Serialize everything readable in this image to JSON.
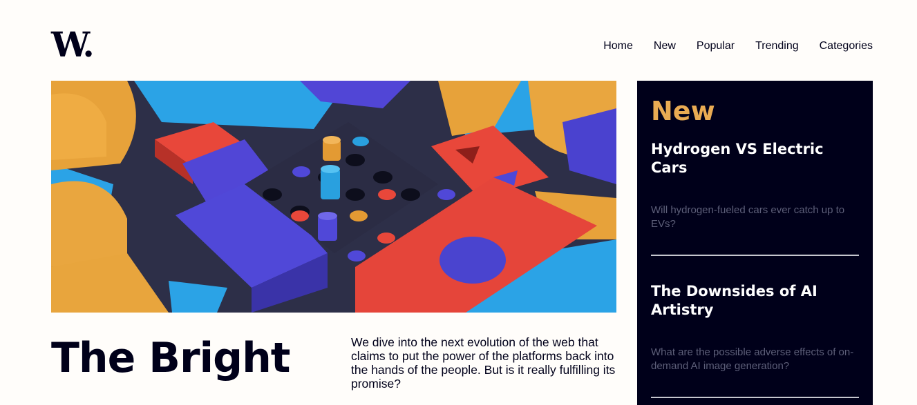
{
  "brand": {
    "logo_text": "W."
  },
  "nav": {
    "items": [
      {
        "label": "Home"
      },
      {
        "label": "New"
      },
      {
        "label": "Popular"
      },
      {
        "label": "Trending"
      },
      {
        "label": "Categories"
      }
    ]
  },
  "hero": {
    "headline": "The Bright",
    "intro": "We dive into the next evolution of the web that claims to put the power of the platforms back into the hands of the people. But is it really fulfilling its promise?"
  },
  "sidebar": {
    "title": "New",
    "articles": [
      {
        "title": "Hydrogen VS Electric Cars",
        "description": "Will hydrogen-fueled cars ever catch up to EVs?"
      },
      {
        "title": "The Downsides of AI Artistry",
        "description": "What are the possible adverse effects of on-demand AI image generation?"
      }
    ]
  },
  "colors": {
    "background": "#fffdfa",
    "dark": "#00001a",
    "accent_orange": "#e9ab53",
    "muted_text": "#5d5f79",
    "divider": "#c5c6ce"
  }
}
